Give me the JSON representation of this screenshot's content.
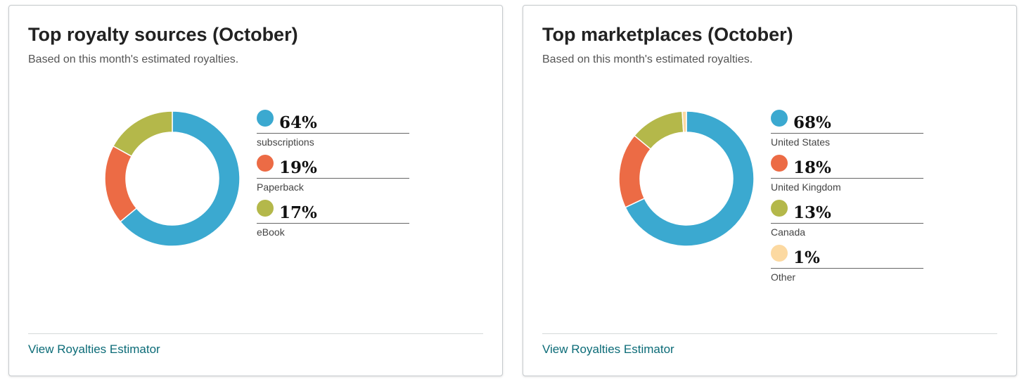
{
  "cards": [
    {
      "title": "Top royalty sources (October)",
      "subtitle": "Based on this month's estimated royalties.",
      "link_label": "View Royalties Estimator"
    },
    {
      "title": "Top marketplaces (October)",
      "subtitle": "Based on this month's estimated royalties.",
      "link_label": "View Royalties Estimator"
    }
  ],
  "colors": {
    "blue": "#3ba9d0",
    "orange": "#ec6b45",
    "olive": "#b4b84a",
    "peach": "#fcd9a1",
    "link": "#0b6b77"
  },
  "chart_data": [
    {
      "type": "pie",
      "donut": true,
      "title": "Top royalty sources (October)",
      "categories": [
        "subscriptions",
        "Paperback",
        "eBook"
      ],
      "values": [
        64,
        19,
        17
      ],
      "value_labels": [
        "64%",
        "19%",
        "17%"
      ],
      "colors": [
        "#3ba9d0",
        "#ec6b45",
        "#b4b84a"
      ],
      "legend_position": "right"
    },
    {
      "type": "pie",
      "donut": true,
      "title": "Top marketplaces (October)",
      "categories": [
        "United States",
        "United Kingdom",
        "Canada",
        "Other"
      ],
      "values": [
        68,
        18,
        13,
        1
      ],
      "value_labels": [
        "68%",
        "18%",
        "13%",
        "1%"
      ],
      "colors": [
        "#3ba9d0",
        "#ec6b45",
        "#b4b84a",
        "#fcd9a1"
      ],
      "legend_position": "right"
    }
  ]
}
